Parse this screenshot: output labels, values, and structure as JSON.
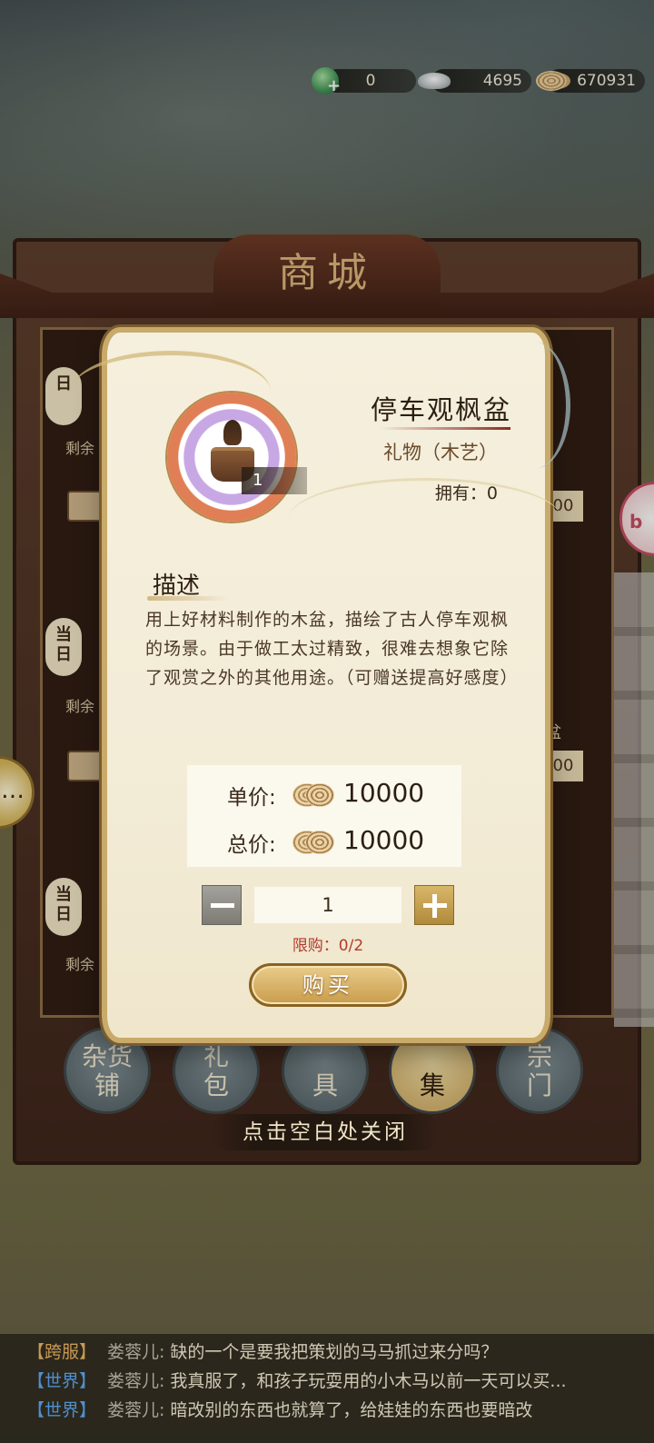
{
  "currency": {
    "jade": "0",
    "silver": "4695",
    "coins": "670931"
  },
  "shop": {
    "title": "商城",
    "side_labels": [
      "日",
      "当\n日",
      "当\n日"
    ],
    "remaining_label": "剩余",
    "right_prices": [
      "00",
      "00"
    ],
    "right_tag": "盆",
    "tabs": [
      {
        "label": "杂货\n铺"
      },
      {
        "label": "礼\n包"
      },
      {
        "label": "\n具"
      },
      {
        "label": "\n集"
      },
      {
        "label": "宗\n门"
      }
    ],
    "close_hint": "点击空白处关闭"
  },
  "right_button_label": "b",
  "item": {
    "name": "停车观枫盆",
    "type": "礼物（木艺）",
    "owned": "拥有：0",
    "count": "1",
    "description_title": "描述",
    "description": "用上好材料制作的木盆，描绘了古人停车观枫的场景。由于做工太过精致，很难去想象它除了观赏之外的其他用途。（可赠送提高好感度）"
  },
  "purchase": {
    "unit_price_label": "单价:",
    "unit_price": "10000",
    "total_price_label": "总价:",
    "total_price": "10000",
    "quantity": "1",
    "limit": "限购：0/2",
    "buy_label": "购买"
  },
  "chat": [
    {
      "channel": "【跨服】",
      "channel_color": "#c79a54",
      "name": "娄蓉儿:",
      "message": "缺的一个是要我把策划的马马抓过来分吗？"
    },
    {
      "channel": "【世界】",
      "channel_color": "#4f8fd0",
      "name": "娄蓉儿:",
      "message": "我真服了，和孩子玩耍用的小木马以前一天可以买..."
    },
    {
      "channel": "【世界】",
      "channel_color": "#4f8fd0",
      "name": "娄蓉儿:",
      "message": "暗改别的东西也就算了，给娃娃的东西也要暗改"
    }
  ]
}
